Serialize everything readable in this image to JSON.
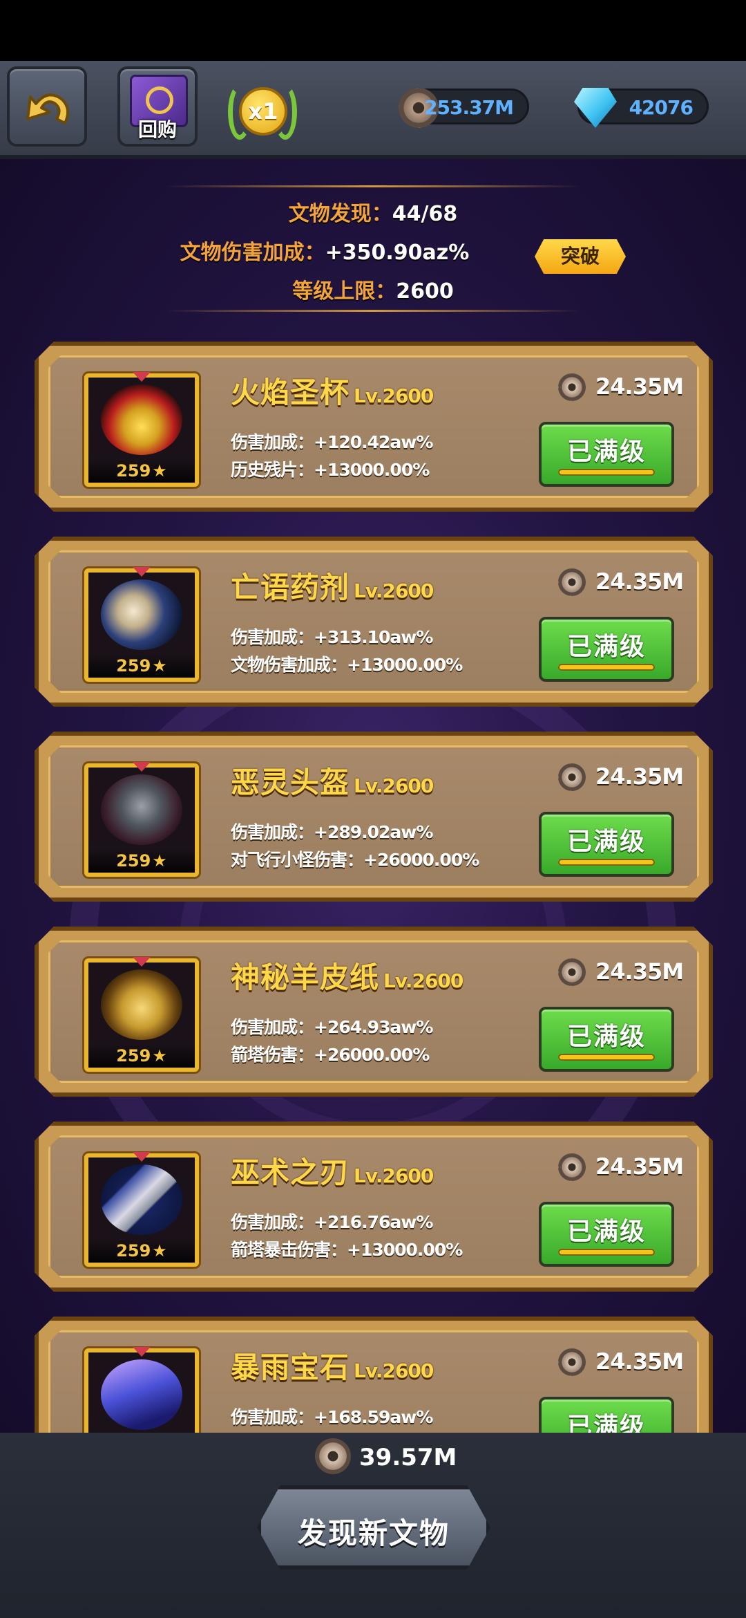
{
  "header": {
    "buyback_label": "回购",
    "speed_label": "x1",
    "gear_currency": "253.37M",
    "gem_currency": "42076"
  },
  "summary": {
    "discovered_label": "文物发现：",
    "discovered_value": "44/68",
    "damage_bonus_label": "文物伤害加成：",
    "damage_bonus_value": "+350.90az%",
    "level_cap_label": "等级上限：",
    "level_cap_value": "2600",
    "breakthrough_label": "突破"
  },
  "relics": [
    {
      "name": "火焰圣杯",
      "level": "Lv.2600",
      "stars": "259",
      "cost": "24.35M",
      "stat1": "伤害加成：+120.42aw%",
      "stat2": "历史残片：+13000.00%",
      "button": "已满级",
      "icon": "fire-chalice-icon"
    },
    {
      "name": "亡语药剂",
      "level": "Lv.2600",
      "stars": "259",
      "cost": "24.35M",
      "stat1": "伤害加成：+313.10aw%",
      "stat2": "文物伤害加成：+13000.00%",
      "button": "已满级",
      "icon": "skull-potion-icon"
    },
    {
      "name": "恶灵头盔",
      "level": "Lv.2600",
      "stars": "259",
      "cost": "24.35M",
      "stat1": "伤害加成：+289.02aw%",
      "stat2": "对飞行小怪伤害：+26000.00%",
      "button": "已满级",
      "icon": "evil-helmet-icon"
    },
    {
      "name": "神秘羊皮纸",
      "level": "Lv.2600",
      "stars": "259",
      "cost": "24.35M",
      "stat1": "伤害加成：+264.93aw%",
      "stat2": "箭塔伤害：+26000.00%",
      "button": "已满级",
      "icon": "parchment-icon"
    },
    {
      "name": "巫术之刃",
      "level": "Lv.2600",
      "stars": "259",
      "cost": "24.35M",
      "stat1": "伤害加成：+216.76aw%",
      "stat2": "箭塔暴击伤害：+13000.00%",
      "button": "已满级",
      "icon": "sorcery-blade-icon"
    },
    {
      "name": "暴雨宝石",
      "level": "Lv.2600",
      "stars": "",
      "cost": "24.35M",
      "stat1": "伤害加成：+168.59aw%",
      "stat2": "",
      "button": "已满级",
      "icon": "storm-gem-icon"
    }
  ],
  "footer": {
    "discover_cost": "39.57M",
    "discover_label": "发现新文物"
  }
}
